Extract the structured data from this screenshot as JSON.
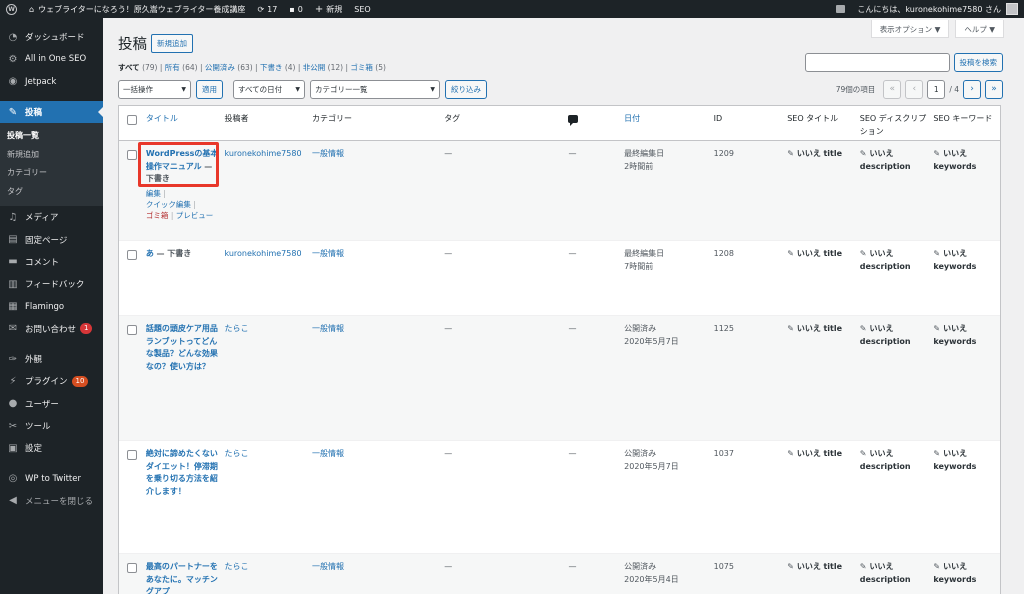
{
  "adminbar": {
    "site_name": "ウェブライターになろう！原久嵩ウェブライター養成講座",
    "updates": "17",
    "comments": "0",
    "new": "新規",
    "seo": "SEO",
    "greeting": "こんにちは、kuronekohime7580 さん"
  },
  "sidebar": {
    "items": [
      {
        "label": "ダッシュボード",
        "icon": "dashboard-icon"
      },
      {
        "label": "All in One SEO",
        "icon": "gear-icon"
      },
      {
        "label": "Jetpack",
        "icon": "jetpack-icon"
      },
      {
        "label": "投稿",
        "icon": "pin-icon"
      },
      {
        "label": "メディア",
        "icon": "media-icon"
      },
      {
        "label": "固定ページ",
        "icon": "page-icon"
      },
      {
        "label": "コメント",
        "icon": "comment-icon"
      },
      {
        "label": "フィードバック",
        "icon": "feedback-icon"
      },
      {
        "label": "Flamingo",
        "icon": "flamingo-icon"
      },
      {
        "label": "お問い合わせ",
        "icon": "mail-icon",
        "badge": "1"
      },
      {
        "label": "外観",
        "icon": "brush-icon"
      },
      {
        "label": "プラグイン",
        "icon": "plugin-icon",
        "badge": "10"
      },
      {
        "label": "ユーザー",
        "icon": "user-icon"
      },
      {
        "label": "ツール",
        "icon": "wrench-icon"
      },
      {
        "label": "設定",
        "icon": "settings-icon"
      },
      {
        "label": "WP to Twitter",
        "icon": "twitter-icon"
      },
      {
        "label": "メニューを閉じる",
        "icon": "collapse-icon"
      }
    ],
    "submenu": [
      "投稿一覧",
      "新規追加",
      "カテゴリー",
      "タグ"
    ]
  },
  "screen_options": "表示オプション ▼",
  "help": "ヘルプ ▼",
  "page_title": "投稿",
  "add_new": "新規追加",
  "filters": {
    "all": "すべて",
    "all_count": "(79)",
    "mine": "所有",
    "mine_count": "(64)",
    "published": "公開済み",
    "published_count": "(63)",
    "draft": "下書き",
    "draft_count": "(4)",
    "private": "非公開",
    "private_count": "(12)",
    "trash": "ゴミ箱",
    "trash_count": "(5)"
  },
  "search_button": "投稿を検索",
  "tablenav": {
    "bulk": "一括操作",
    "apply": "適用",
    "dates": "すべての日付",
    "category": "カテゴリー一覧",
    "filter": "絞り込み",
    "items": "79個の項目",
    "first": "«",
    "prev": "‹",
    "page": "1",
    "of": "/ 4",
    "next": "›",
    "last": "»"
  },
  "columns": {
    "title": "タイトル",
    "author": "投稿者",
    "category": "カテゴリー",
    "tags": "タグ",
    "date": "日付",
    "id": "ID",
    "seo_title": "SEO タイトル",
    "seo_desc": "SEO ディスクリプション",
    "seo_keywords": "SEO キーワード"
  },
  "row_actions": {
    "edit": "編集",
    "quick_edit": "クイック編集",
    "trash": "ゴミ箱",
    "preview": "プレビュー"
  },
  "seo_values": {
    "no": "いいえ",
    "title": "title",
    "description": "description",
    "keywords": "keywords"
  },
  "posts": [
    {
      "title": "WordPressの基本操作マニュアル",
      "state": "— 下書き",
      "author": "kuronekohime7580",
      "category": "一般情報",
      "tags": "—",
      "comments": "—",
      "status": "最終編集日",
      "date": "2時間前",
      "id": "1209"
    },
    {
      "title": "あ",
      "state": "— 下書き",
      "author": "kuronekohime7580",
      "category": "一般情報",
      "tags": "—",
      "comments": "—",
      "status": "最終編集日",
      "date": "7時間前",
      "id": "1208"
    },
    {
      "title": "話題の頭皮ケア用品ランブットってどんな製品？どんな効果なの？使い方は？",
      "state": "",
      "author": "たらこ",
      "category": "一般情報",
      "tags": "—",
      "comments": "—",
      "status": "公開済み",
      "date": "2020年5月7日",
      "id": "1125"
    },
    {
      "title": "絶対に諦めたくないダイエット！停滞期を乗り切る方法を紹介します！",
      "state": "",
      "author": "たらこ",
      "category": "一般情報",
      "tags": "—",
      "comments": "—",
      "status": "公開済み",
      "date": "2020年5月7日",
      "id": "1037"
    },
    {
      "title": "最高のパートナーをあなたに。マッチングアプ",
      "state": "",
      "author": "たらこ",
      "category": "一般情報",
      "tags": "—",
      "comments": "—",
      "status": "公開済み",
      "date": "2020年5月4日",
      "id": "1075"
    }
  ]
}
